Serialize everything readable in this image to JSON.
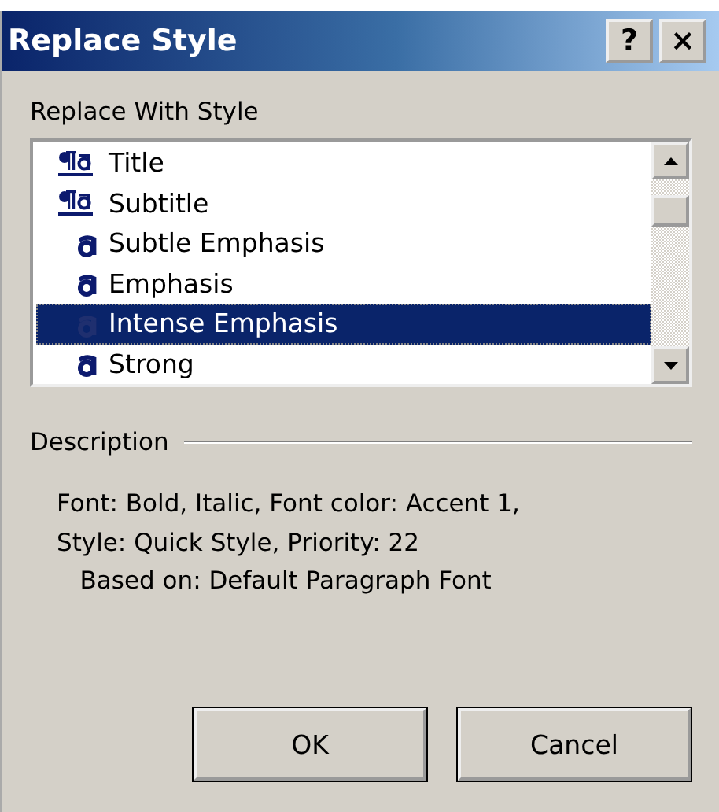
{
  "window": {
    "title": "Replace Style",
    "help_button": "?",
    "close_button": "×"
  },
  "list_label": "Replace With Style",
  "styles": [
    {
      "label": "Title",
      "kind": "paragraph",
      "selected": false
    },
    {
      "label": "Subtitle",
      "kind": "paragraph",
      "selected": false
    },
    {
      "label": "Subtle Emphasis",
      "kind": "character",
      "selected": false
    },
    {
      "label": "Emphasis",
      "kind": "character",
      "selected": false
    },
    {
      "label": "Intense Emphasis",
      "kind": "character",
      "selected": true
    },
    {
      "label": "Strong",
      "kind": "character",
      "selected": false
    }
  ],
  "description": {
    "heading": "Description",
    "lines": [
      "Font: Bold, Italic, Font color: Accent 1,",
      "Style: Quick Style, Priority: 22",
      "   Based on: Default Paragraph Font"
    ]
  },
  "buttons": [
    "OK",
    "Cancel"
  ]
}
